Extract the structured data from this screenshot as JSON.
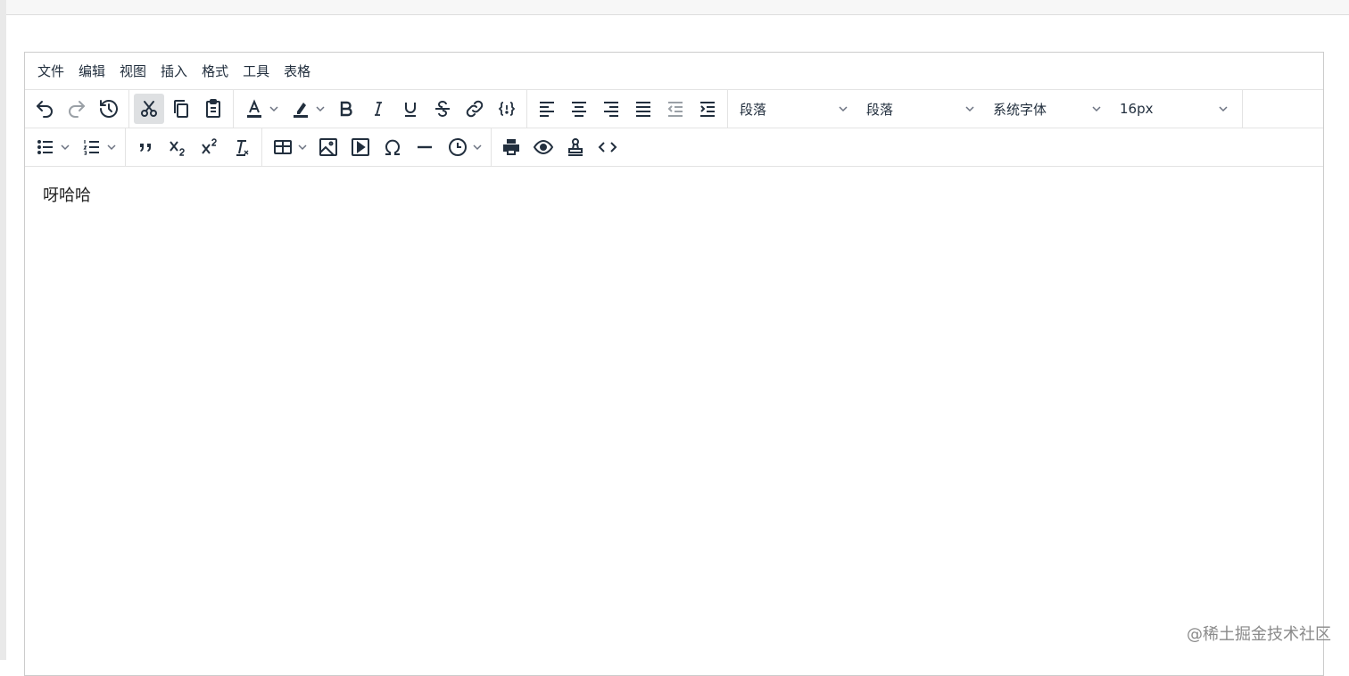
{
  "menubar": [
    "文件",
    "编辑",
    "视图",
    "插入",
    "格式",
    "工具",
    "表格"
  ],
  "toolbar1": {
    "undo_icon": "undo-icon",
    "redo_icon": "redo-icon",
    "history_icon": "history-icon",
    "cut_icon": "cut-icon",
    "copy_icon": "copy-icon",
    "paste_icon": "paste-icon",
    "selects": [
      "段落",
      "段落",
      "系统字体",
      "16px"
    ]
  },
  "toolbar2": {
    "icons": [
      "bullet-list-icon",
      "numbered-list-icon",
      "blockquote-icon",
      "subscript-icon",
      "superscript-icon",
      "remove-format-icon",
      "table-icon",
      "image-icon",
      "media-icon",
      "special-char-icon",
      "horizontal-rule-icon",
      "datetime-icon",
      "print-icon",
      "preview-icon",
      "stamp-icon",
      "code-view-icon"
    ]
  },
  "content": {
    "text": "呀哈哈"
  },
  "watermark": "@稀土掘金技术社区",
  "colors": {
    "border": "#cccccc",
    "active_bg": "#dee0e2",
    "text": "#222f3e"
  }
}
